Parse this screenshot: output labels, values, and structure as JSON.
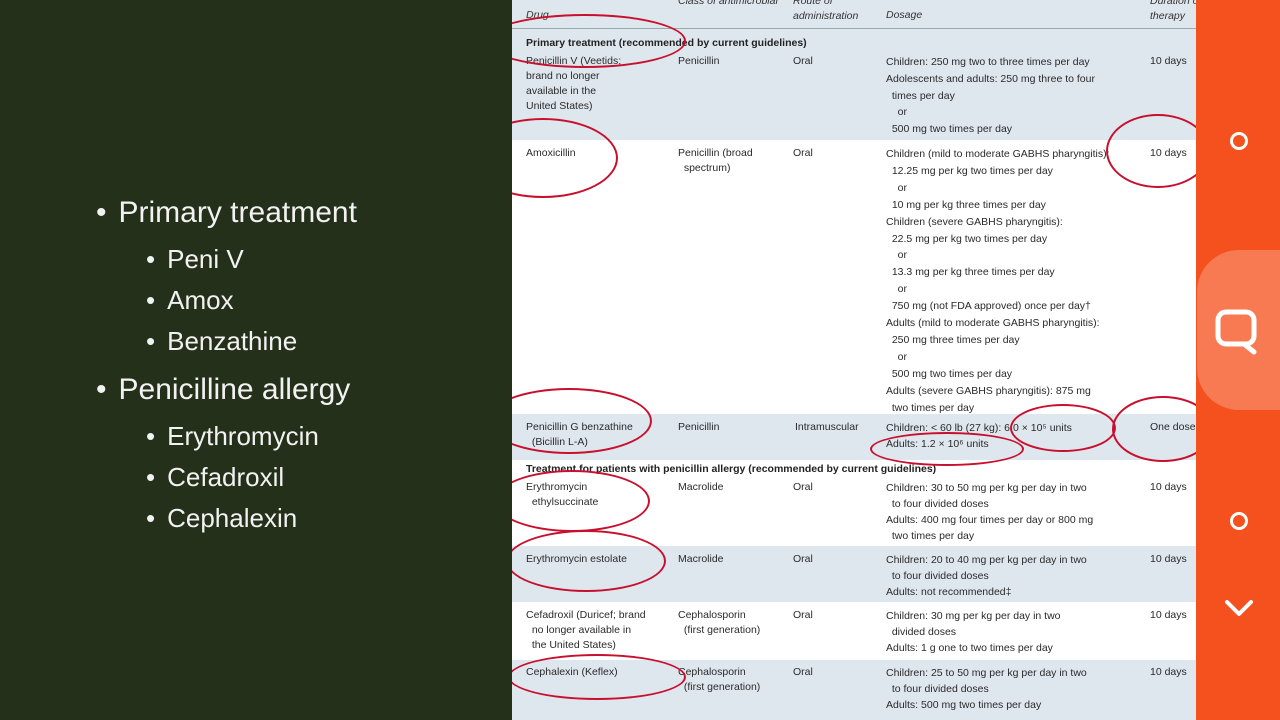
{
  "slide": {
    "bullets": [
      {
        "text": "Primary treatment",
        "sub": [
          "Peni V",
          "Amox",
          "Benzathine"
        ]
      },
      {
        "text": "Penicilline allergy",
        "sub": [
          "Erythromycin",
          "Cefadroxil",
          "Cephalexin"
        ]
      }
    ]
  },
  "table": {
    "headers": {
      "drug": "Drug",
      "class": "Class of antimicrobial",
      "route": "Route of administration",
      "dosage": "Dosage",
      "duration": "Duration of therapy"
    },
    "section1": "Primary treatment (recommended by current guidelines)",
    "section2": "Treatment for patients with penicillin allergy (recommended by current guidelines)",
    "rows": [
      {
        "drug": "Penicillin V (Veetids;\nbrand no longer\navailable in the\nUnited States)",
        "class": "Penicillin",
        "route": "Oral",
        "dosage": "Children: 250 mg two to three times per day\nAdolescents and adults: 250 mg three to four\n  times per day\n    or\n  500 mg two times per day",
        "duration": "10 days"
      },
      {
        "drug": "Amoxicillin",
        "class": "Penicillin (broad\n  spectrum)",
        "route": "Oral",
        "dosage": "Children (mild to moderate GABHS pharyngitis):\n  12.25 mg per kg two times per day\n    or\n  10 mg per kg three times per day\nChildren (severe GABHS pharyngitis):\n  22.5 mg per kg two times per day\n    or\n  13.3 mg per kg three times per day\n    or\n  750 mg (not FDA approved) once per day†\nAdults (mild to moderate GABHS pharyngitis):\n  250 mg three times per day\n    or\n  500 mg two times per day\nAdults (severe GABHS pharyngitis): 875 mg\n  two times per day",
        "duration": "10 days"
      },
      {
        "drug": "Penicillin G benzathine\n  (Bicillin L-A)",
        "class": "Penicillin",
        "route": "Intramuscular",
        "dosage": "Children: < 60 lb (27 kg): 6.0 × 10⁵ units\nAdults: 1.2 × 10⁶ units",
        "duration": "One dose"
      },
      {
        "drug": "Erythromycin\n  ethylsuccinate",
        "class": "Macrolide",
        "route": "Oral",
        "dosage": "Children: 30 to 50 mg per kg per day in two\n  to four divided doses\nAdults: 400 mg four times per day or 800 mg\n  two times per day",
        "duration": "10 days"
      },
      {
        "drug": "Erythromycin estolate",
        "class": "Macrolide",
        "route": "Oral",
        "dosage": "Children: 20 to 40 mg per kg per day in two\n  to four divided doses\nAdults: not recommended‡",
        "duration": "10 days"
      },
      {
        "drug": "Cefadroxil (Duricef; brand\n  no longer available in\n  the United States)",
        "class": "Cephalosporin\n  (first generation)",
        "route": "Oral",
        "dosage": "Children: 30 mg per kg per day in two\n  divided doses\nAdults: 1 g one to two times per day",
        "duration": "10 days"
      },
      {
        "drug": "Cephalexin (Keflex)",
        "class": "Cephalosporin\n  (first generation)",
        "route": "Oral",
        "dosage": "Children: 25 to 50 mg per kg per day in two\n  to four divided doses\nAdults: 500 mg two times per day",
        "duration": "10 days"
      }
    ]
  },
  "controls": {
    "icons": [
      "circle-icon",
      "chat-tool-icon",
      "circle-icon",
      "chevron-down-icon"
    ]
  }
}
